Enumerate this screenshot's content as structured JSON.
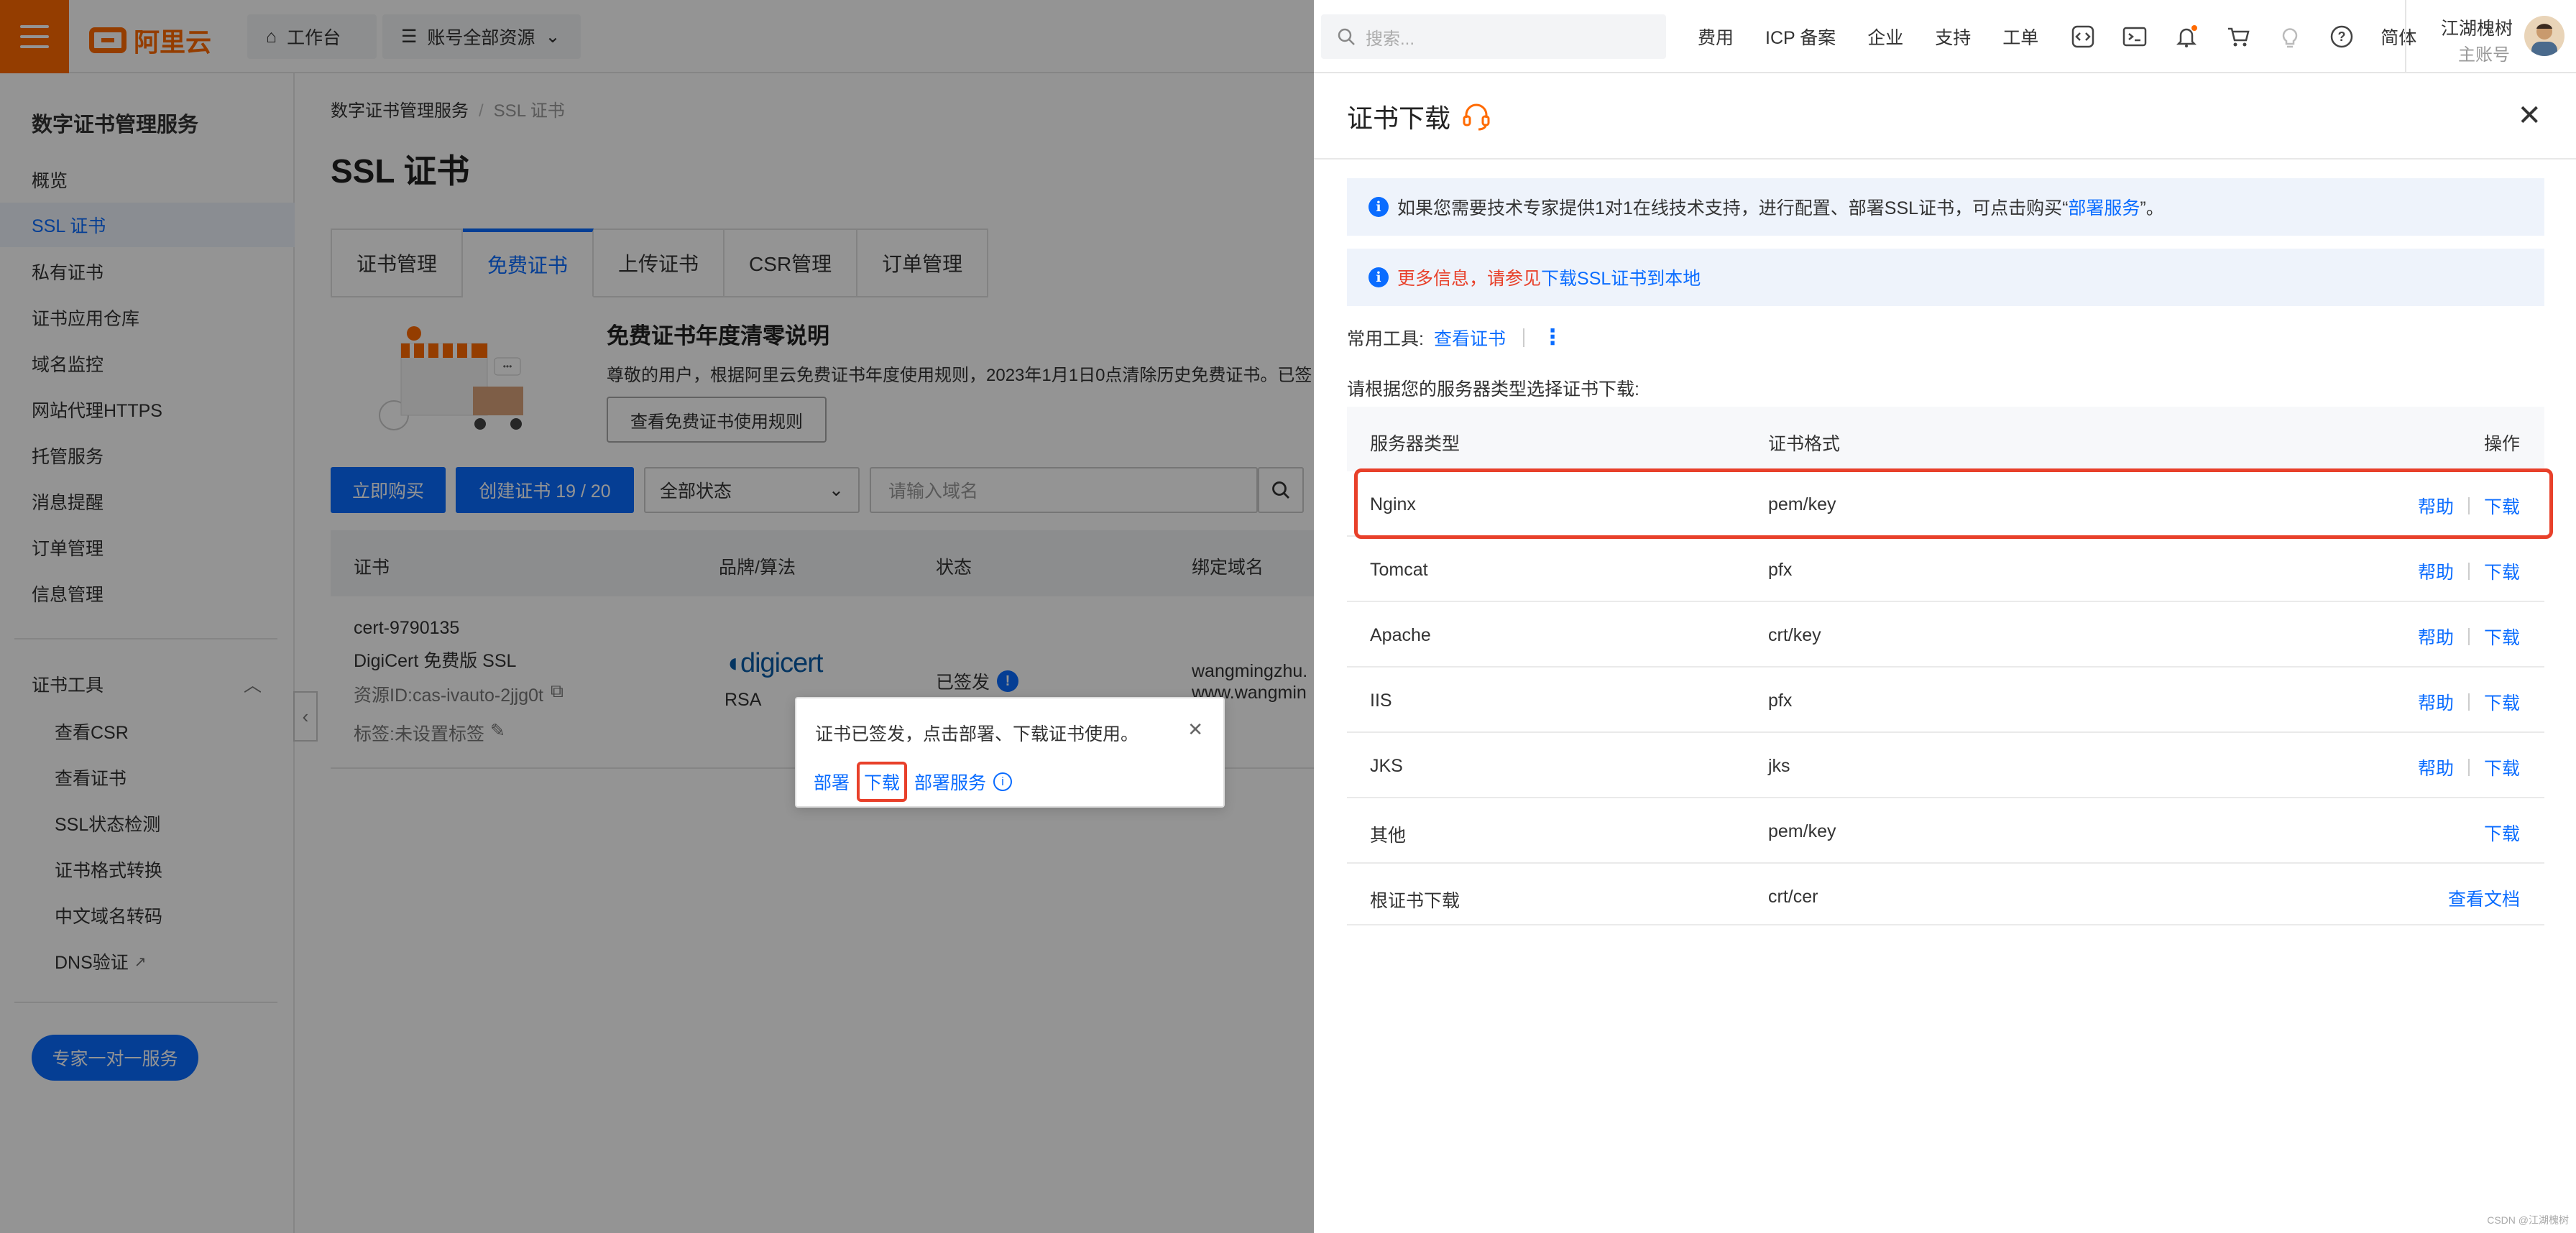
{
  "topbar": {
    "logo_text": "阿里云",
    "workbench": "工作台",
    "resources": "账号全部资源",
    "search_placeholder": "搜索...",
    "nav": [
      "费用",
      "ICP 备案",
      "企业",
      "支持",
      "工单"
    ],
    "lang": "简体",
    "user_name": "江湖槐树",
    "user_role": "主账号",
    "brand_color": "#ff6a00"
  },
  "sidebar": {
    "title": "数字证书管理服务",
    "items": [
      "概览",
      "SSL 证书",
      "私有证书",
      "证书应用仓库",
      "域名监控",
      "网站代理HTTPS",
      "托管服务",
      "消息提醒",
      "订单管理",
      "信息管理"
    ],
    "tools_title": "证书工具",
    "tools": [
      "查看CSR",
      "查看证书",
      "SSL状态检测",
      "证书格式转换",
      "中文域名转码",
      "DNS验证"
    ],
    "expert_button": "专家一对一服务"
  },
  "main": {
    "breadcrumb": [
      "数字证书管理服务",
      "SSL 证书"
    ],
    "title": "SSL 证书",
    "tabs": [
      "证书管理",
      "免费证书",
      "上传证书",
      "CSR管理",
      "订单管理"
    ],
    "banner": {
      "title": "免费证书年度清零说明",
      "text": "尊敬的用户，根据阿里云免费证书年度使用规则，2023年1月1日0点清除历史免费证书。已签",
      "button": "查看免费证书使用规则"
    },
    "toolbar": {
      "buy": "立即购买",
      "create": "创建证书 19 / 20",
      "status_select": "全部状态",
      "domain_placeholder": "请输入域名"
    },
    "table_headers": [
      "证书",
      "品牌/算法",
      "状态",
      "绑定域名"
    ],
    "row": {
      "cert_name": "cert-9790135",
      "cert_type": "DigiCert 免费版 SSL",
      "resource_id": "资源ID:cas-ivauto-2jjg0t",
      "tag": "标签:未设置标签",
      "brand": "digicert",
      "algo": "RSA",
      "status": "已签发",
      "domain1": "wangmingzhu.",
      "domain2": "www.wangmin"
    },
    "popover": {
      "message": "证书已签发，点击部署、下载证书使用。",
      "deploy": "部署",
      "download": "下载",
      "deploy_service": "部署服务"
    }
  },
  "drawer": {
    "title": "证书下载",
    "alert1_pre": "如果您需要技术专家提供1对1在线技术支持，进行配置、部署SSL证书，可点击购买“",
    "alert1_link": "部署服务",
    "alert1_post": "”。",
    "alert2_pre": "更多信息，请参见",
    "alert2_link": "下载SSL证书到本地",
    "tools_label": "常用工具:",
    "tools_link": "查看证书",
    "hint": "请根据您的服务器类型选择证书下载:",
    "headers": [
      "服务器类型",
      "证书格式",
      "操作"
    ],
    "rows": [
      {
        "server": "Nginx",
        "format": "pem/key",
        "help": "帮助",
        "action": "下载"
      },
      {
        "server": "Tomcat",
        "format": "pfx",
        "help": "帮助",
        "action": "下载"
      },
      {
        "server": "Apache",
        "format": "crt/key",
        "help": "帮助",
        "action": "下载"
      },
      {
        "server": "IIS",
        "format": "pfx",
        "help": "帮助",
        "action": "下载"
      },
      {
        "server": "JKS",
        "format": "jks",
        "help": "帮助",
        "action": "下载"
      },
      {
        "server": "其他",
        "format": "pem/key",
        "help": "",
        "action": "下载"
      },
      {
        "server": "根证书下载",
        "format": "crt/cer",
        "help": "",
        "action": "查看文档"
      }
    ]
  },
  "credit": "CSDN @江湖槐树",
  "colors": {
    "accent": "#0a6cff",
    "highlight": "#e8402a"
  }
}
